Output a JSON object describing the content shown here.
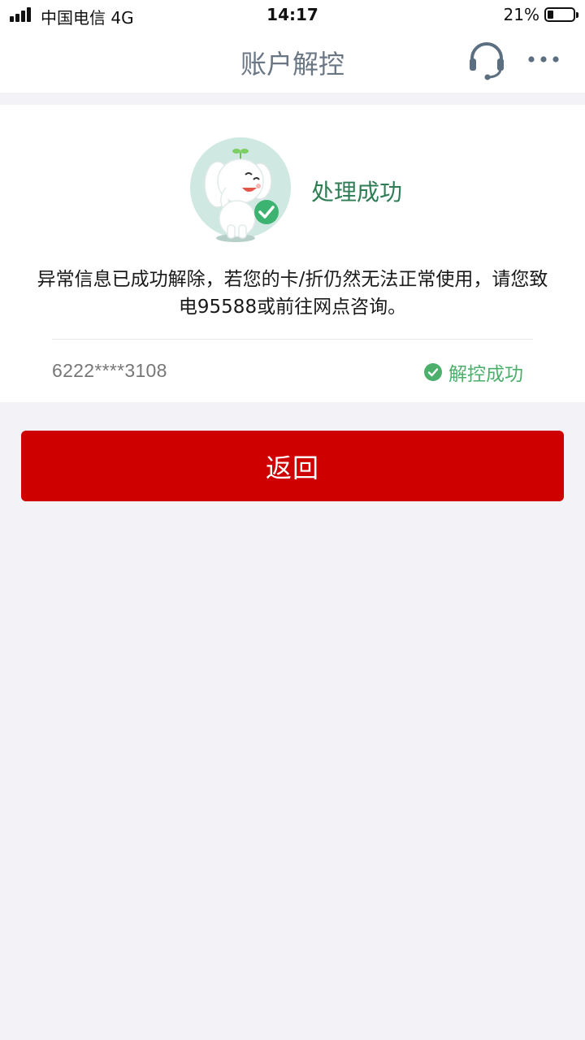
{
  "status_bar": {
    "carrier": "中国电信  4G",
    "time": "14:17",
    "battery": "21%"
  },
  "nav": {
    "title": "账户解控",
    "service_icon": "headset-icon",
    "more_icon": "more-dots-icon"
  },
  "result": {
    "mascot_icon": "elephant-mascot-success-icon",
    "title": "处理成功",
    "message": "异常信息已成功解除，若您的卡/折仍然无法正常使用，请您致电95588或前往网点咨询。",
    "card_number": "6222****3108",
    "status": "解控成功",
    "status_icon": "check-circle-icon"
  },
  "actions": {
    "return_label": "返回"
  },
  "colors": {
    "primary_red": "#cf0000",
    "success_green": "#4caf6c",
    "title_green": "#2e7d55",
    "page_bg": "#f2f2f7"
  }
}
